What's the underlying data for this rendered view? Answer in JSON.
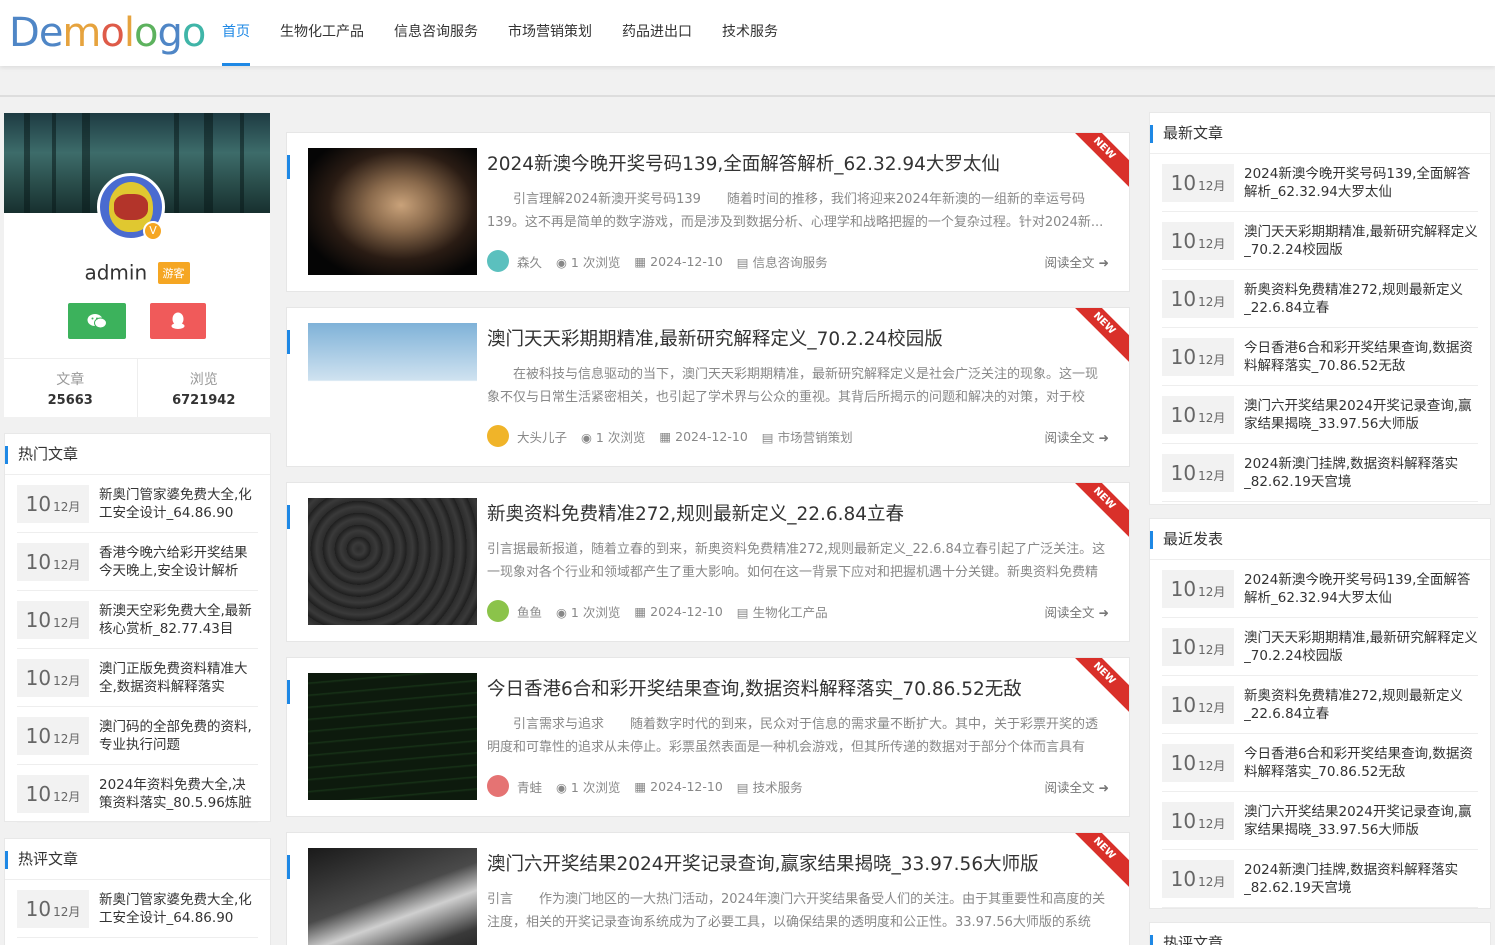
{
  "header": {
    "logo_letters": [
      "D",
      "e",
      "m",
      "o",
      "l",
      "o",
      "g",
      "o"
    ],
    "logo_colors": [
      "#4f86c6",
      "#4f86c6",
      "#e6a33e",
      "#de5b49",
      "#e6a33e",
      "#5db25e",
      "#4f86c6",
      "#40b5a8"
    ],
    "nav": [
      {
        "label": "首页",
        "active": true
      },
      {
        "label": "生物化工产品",
        "active": false
      },
      {
        "label": "信息咨询服务",
        "active": false
      },
      {
        "label": "市场营销策划",
        "active": false
      },
      {
        "label": "药品进出口",
        "active": false
      },
      {
        "label": "技术服务",
        "active": false
      }
    ]
  },
  "profile": {
    "name": "admin",
    "tag": "游客",
    "badge": "V",
    "stats": [
      {
        "label": "文章",
        "value": "25663"
      },
      {
        "label": "浏览",
        "value": "6721942"
      }
    ]
  },
  "hot_articles": {
    "title": "热门文章",
    "items": [
      {
        "day": "10",
        "month": "12月",
        "title": "新奥门管家婆免费大全,化工安全设计_64.86.90"
      },
      {
        "day": "10",
        "month": "12月",
        "title": "香港今晚六给彩开奖结果今天晚上,安全设计解析"
      },
      {
        "day": "10",
        "month": "12月",
        "title": "新澳天空彩免费大全,最新核心赏析_82.77.43目"
      },
      {
        "day": "10",
        "month": "12月",
        "title": "澳门正版免费资料精准大全,数据资料解释落实"
      },
      {
        "day": "10",
        "month": "12月",
        "title": "澳门码的全部免费的资料,专业执行问题"
      },
      {
        "day": "10",
        "month": "12月",
        "title": "2024年资料免费大全,决策资料落实_80.5.96炼脏"
      }
    ]
  },
  "hot_comments": {
    "title": "热评文章",
    "items": [
      {
        "day": "10",
        "month": "12月",
        "title": "新奥门管家婆免费大全,化工安全设计_64.86.90"
      }
    ]
  },
  "posts": [
    {
      "title": "2024新澳今晚开奖号码139,全面解答解析_62.32.94大罗太仙",
      "excerpt": "　　引言理解2024新澳开奖号码139　　随着时间的推移，我们将迎来2024年新澳的一组新的幸运号码139。这不再是简单的数字游戏，而是涉及到数据分析、心理学和战略把握的一个复杂过程。针对2024新...",
      "author": "森久",
      "views": "1 次浏览",
      "date": "2024-12-10",
      "category": "信息咨询服务",
      "readmore": "阅读全文",
      "ribbon": "NEW",
      "avatar_color": "#5bc0be"
    },
    {
      "title": "澳门天天彩期期精准,最新研究解释定义_70.2.24校园版",
      "excerpt": "　　在被科技与信息驱动的当下，澳门天天彩期期精准，最新研究解释定义是社会广泛关注的现象。这一现象不仅与日常生活紧密相关，也引起了学术界与公众的重视。其背后所揭示的问题和解决的对策，对于校园...",
      "author": "大头儿子",
      "views": "1 次浏览",
      "date": "2024-12-10",
      "category": "市场营销策划",
      "readmore": "阅读全文",
      "ribbon": "NEW",
      "avatar_color": "#f0b429"
    },
    {
      "title": "新奥资料免费精准272,规则最新定义_22.6.84立春",
      "excerpt": "引言据最新报道，随着立春的到来，新奥资料免费精准272,规则最新定义_22.6.84立春引起了广泛关注。这一现象对各个行业和领域都产生了重大影响。如何在这一背景下应对和把握机遇十分关键。新奥资料免费精准...",
      "author": "鱼鱼",
      "views": "1 次浏览",
      "date": "2024-12-10",
      "category": "生物化工产品",
      "readmore": "阅读全文",
      "ribbon": "NEW",
      "avatar_color": "#8bc34a"
    },
    {
      "title": "今日香港6合和彩开奖结果查询,数据资料解释落实_70.86.52无敌",
      "excerpt": "　　引言需求与追求　　随着数字时代的到来，民众对于信息的需求量不断扩大。其中，关于彩票开奖的透明度和可靠性的追求从未停止。彩票虽然表面是一种机会游戏，但其所传递的数据对于部分个体而言具有现...",
      "author": "青蛙",
      "views": "1 次浏览",
      "date": "2024-12-10",
      "category": "技术服务",
      "readmore": "阅读全文",
      "ribbon": "NEW",
      "avatar_color": "#e57373"
    },
    {
      "title": "澳门六开奖结果2024开奖记录查询,赢家结果揭晓_33.97.56大师版",
      "excerpt": "引言　　作为澳门地区的一大热门活动，2024年澳门六开奖结果备受人们的关注。由于其重要性和高度的关注度，相关的开奖记录查询系统成为了必要工具，以确保结果的透明度和公正性。33.97.56大师版的系统从...",
      "author": "",
      "views": "",
      "date": "",
      "category": "",
      "readmore": "",
      "ribbon": "NEW",
      "avatar_color": "#999999"
    }
  ],
  "latest_articles": {
    "title": "最新文章",
    "items": [
      {
        "day": "10",
        "month": "12月",
        "title": "2024新澳今晚开奖号码139,全面解答解析_62.32.94大罗太仙"
      },
      {
        "day": "10",
        "month": "12月",
        "title": "澳门天天彩期期精准,最新研究解释定义_70.2.24校园版"
      },
      {
        "day": "10",
        "month": "12月",
        "title": "新奥资料免费精准272,规则最新定义_22.6.84立春"
      },
      {
        "day": "10",
        "month": "12月",
        "title": "今日香港6合和彩开奖结果查询,数据资料解释落实_70.86.52无敌"
      },
      {
        "day": "10",
        "month": "12月",
        "title": "澳门六开奖结果2024开奖记录查询,赢家结果揭晓_33.97.56大师版"
      },
      {
        "day": "10",
        "month": "12月",
        "title": "2024新澳门挂牌,数据资料解释落实_82.62.19天宫境"
      }
    ]
  },
  "recent_posts": {
    "title": "最近发表",
    "items": [
      {
        "day": "10",
        "month": "12月",
        "title": "2024新澳今晚开奖号码139,全面解答解析_62.32.94大罗太仙"
      },
      {
        "day": "10",
        "month": "12月",
        "title": "澳门天天彩期期精准,最新研究解释定义_70.2.24校园版"
      },
      {
        "day": "10",
        "month": "12月",
        "title": "新奥资料免费精准272,规则最新定义_22.6.84立春"
      },
      {
        "day": "10",
        "month": "12月",
        "title": "今日香港6合和彩开奖结果查询,数据资料解释落实_70.86.52无敌"
      },
      {
        "day": "10",
        "month": "12月",
        "title": "澳门六开奖结果2024开奖记录查询,赢家结果揭晓_33.97.56大师版"
      },
      {
        "day": "10",
        "month": "12月",
        "title": "2024新澳门挂牌,数据资料解释落实_82.62.19天宫境"
      }
    ]
  },
  "hot_comments_right": {
    "title": "热评文章"
  }
}
